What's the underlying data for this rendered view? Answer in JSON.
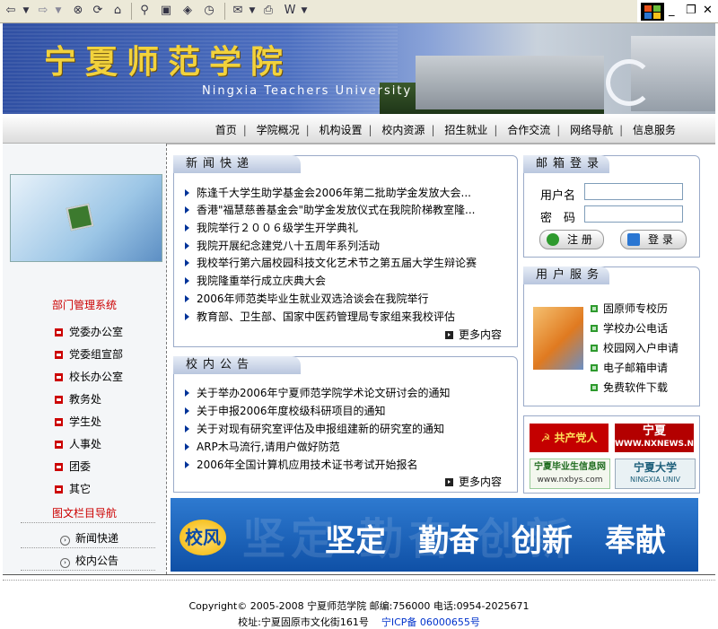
{
  "banner": {
    "title": "宁夏师范学院",
    "subtitle": "Ningxia Teachers University"
  },
  "nav": {
    "items": [
      "首页",
      "学院概况",
      "机构设置",
      "校内资源",
      "招生就业",
      "合作交流",
      "网络导航",
      "信息服务"
    ],
    "separator": "|"
  },
  "left": {
    "dept_title": "部门管理系统",
    "dept_items": [
      "党委办公室",
      "党委组宣部",
      "校长办公室",
      "教务处",
      "学生处",
      "人事处",
      "团委",
      "其它"
    ],
    "nav_title": "图文栏目导航",
    "nav_items": [
      "新闻快递",
      "校内公告"
    ]
  },
  "news": {
    "title": "新闻快递",
    "items": [
      "陈逢千大学生助学基金会2006年第二批助学金发放大会...",
      "香港\"福慧慈善基金会\"助学金发放仪式在我院阶梯教室隆...",
      "我院举行２００６级学生开学典礼",
      "我院开展纪念建党八十五周年系列活动",
      "我校举行第六届校园科技文化艺术节之第五届大学生辩论赛",
      "我院隆重举行成立庆典大会",
      "2006年师范类毕业生就业双选洽谈会在我院举行",
      "教育部、卫生部、国家中医药管理局专家组来我校评估"
    ],
    "more": "更多内容"
  },
  "notice": {
    "title": "校内公告",
    "items": [
      "关于举办2006年宁夏师范学院学术论文研讨会的通知",
      "关于申报2006年度校级科研项目的通知",
      "关于对现有研究室评估及申报组建新的研究室的通知",
      "ARP木马流行,请用户做好防范",
      "2006年全国计算机应用技术证书考试开始报名"
    ],
    "more": "更多内容"
  },
  "mailbox": {
    "title": "邮箱登录",
    "username_label": "用户名",
    "password_label": "密　码",
    "register_label": "注 册",
    "login_label": "登 录"
  },
  "services": {
    "title": "用户服务",
    "items": [
      "固原师专校历",
      "学校办公电话",
      "校园网入户申请",
      "电子邮箱申请",
      "免费软件下载"
    ]
  },
  "links": {
    "party": "共产党人",
    "nxnews_top": "宁夏",
    "nxnews_url": "WWW.NXNEWS.NET",
    "grad_top": "宁夏毕业生信息网",
    "grad_url": "www.nxbys.com",
    "univ_top": "宁夏大学",
    "univ_sub": "NINGXIA UNIV"
  },
  "slogan": {
    "badge": "校风",
    "words": [
      "坚定",
      "勤奋",
      "创新",
      "奉献"
    ],
    "bg_text": "坚定 勤奋 创新"
  },
  "footer": {
    "line1": "Copyright© 2005-2008 宁夏师范学院 邮编:756000 电话:0954-2025671",
    "line2": "校址:宁夏固原市文化街161号",
    "icp": "宁ICP备 06000655号"
  },
  "colors": {
    "accent_red": "#cc0000",
    "banner_blue": "#2f4fa3",
    "title_gold": "#f2d23c",
    "slogan_blue": "#0f50a6"
  }
}
